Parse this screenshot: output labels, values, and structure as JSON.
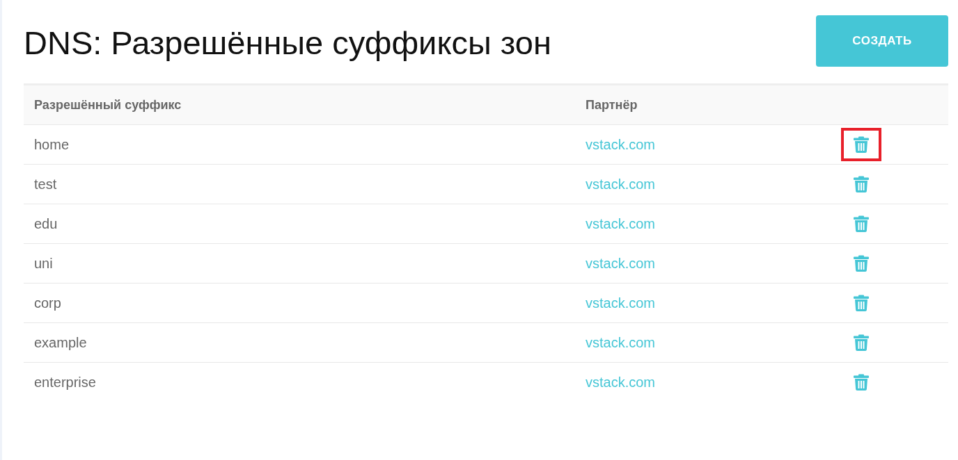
{
  "page": {
    "title": "DNS: Разрешённые суффиксы зон",
    "create_button": "СОЗДАТЬ"
  },
  "table": {
    "columns": [
      "Разрешённый суффикс",
      "Партнёр"
    ],
    "rows": [
      {
        "suffix": "home",
        "partner": "vstack.com",
        "highlighted": true
      },
      {
        "suffix": "test",
        "partner": "vstack.com",
        "highlighted": false
      },
      {
        "suffix": "edu",
        "partner": "vstack.com",
        "highlighted": false
      },
      {
        "suffix": "uni",
        "partner": "vstack.com",
        "highlighted": false
      },
      {
        "suffix": "corp",
        "partner": "vstack.com",
        "highlighted": false
      },
      {
        "suffix": "example",
        "partner": "vstack.com",
        "highlighted": false
      },
      {
        "suffix": "enterprise",
        "partner": "vstack.com",
        "highlighted": false
      }
    ]
  }
}
